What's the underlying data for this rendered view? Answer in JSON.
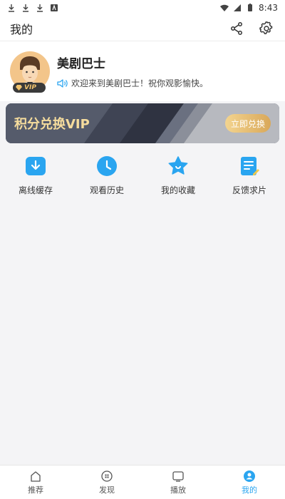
{
  "status_bar": {
    "time": "8:43"
  },
  "header": {
    "title": "我的",
    "share_icon": "share-icon",
    "settings_icon": "gear-icon"
  },
  "profile": {
    "username": "美剧巴士",
    "welcome": "欢迎来到美剧巴士！祝你观影愉快。",
    "badge": "VIP"
  },
  "vip_banner": {
    "title": "积分兑换VIP",
    "button": "立即兑换"
  },
  "quick_menu": [
    {
      "label": "离线缓存",
      "icon": "download-icon",
      "color": "#2aa5f0"
    },
    {
      "label": "观看历史",
      "icon": "clock-icon",
      "color": "#2aa5f0"
    },
    {
      "label": "我的收藏",
      "icon": "star-icon",
      "color": "#2aa5f0"
    },
    {
      "label": "反馈求片",
      "icon": "feedback-icon",
      "color": "#2aa5f0"
    }
  ],
  "bottom_nav": [
    {
      "label": "推荐",
      "icon": "home-icon",
      "active": false
    },
    {
      "label": "发现",
      "icon": "discover-icon",
      "active": false
    },
    {
      "label": "播放",
      "icon": "play-icon",
      "active": false
    },
    {
      "label": "我的",
      "icon": "profile-icon",
      "active": true
    }
  ],
  "colors": {
    "accent": "#2aa5f0",
    "gold": "#f5dc9d",
    "banner_bg": "#4d5363"
  }
}
